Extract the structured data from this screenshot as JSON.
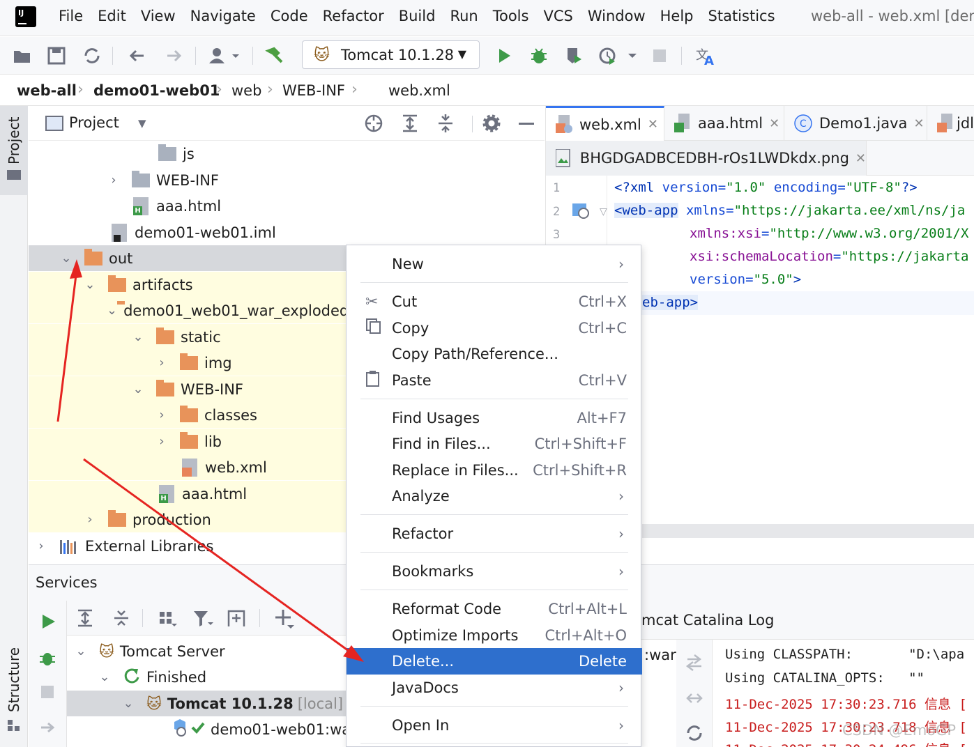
{
  "menubar": {
    "items": [
      "File",
      "Edit",
      "View",
      "Navigate",
      "Code",
      "Refactor",
      "Build",
      "Run",
      "Tools",
      "VCS",
      "Window",
      "Help",
      "Statistics"
    ],
    "window_title": "web-all - web.xml [dem"
  },
  "toolbar": {
    "run_config": "Tomcat 10.1.28"
  },
  "breadcrumb": [
    "web-all",
    "demo01-web01",
    "web",
    "WEB-INF",
    "web.xml"
  ],
  "leftstrip": {
    "project": "Project",
    "structure": "Structure"
  },
  "project": {
    "title": "Project",
    "tree": [
      {
        "label": "js",
        "type": "folder-gray"
      },
      {
        "label": "WEB-INF",
        "type": "folder-gray"
      },
      {
        "label": "aaa.html",
        "type": "html"
      },
      {
        "label": "demo01-web01.iml",
        "type": "iml"
      },
      {
        "label": "out",
        "type": "folder-orange"
      },
      {
        "label": "artifacts",
        "type": "folder-orange"
      },
      {
        "label": "demo01_web01_war_exploded",
        "type": "folder-orange"
      },
      {
        "label": "static",
        "type": "folder-orange"
      },
      {
        "label": "img",
        "type": "folder-orange"
      },
      {
        "label": "WEB-INF",
        "type": "folder-orange"
      },
      {
        "label": "classes",
        "type": "folder-orange"
      },
      {
        "label": "lib",
        "type": "folder-orange"
      },
      {
        "label": "web.xml",
        "type": "xml"
      },
      {
        "label": "aaa.html",
        "type": "html"
      },
      {
        "label": "production",
        "type": "folder-orange"
      },
      {
        "label": "External Libraries",
        "type": "libs"
      }
    ]
  },
  "editor": {
    "tabs": [
      "web.xml",
      "aaa.html",
      "Demo1.java",
      "jdl"
    ],
    "tab2": "BHGDGADBCEDBH-rOs1LWDkdx.png",
    "lines": [
      "1",
      "2",
      "3"
    ],
    "code": {
      "l1a": "<?",
      "l1b": "xml",
      "l1c": " version=",
      "l1d": "\"1.0\"",
      "l1e": " encoding=",
      "l1f": "\"UTF-8\"",
      "l1g": "?>",
      "l2a": "<web-app",
      "l2b": " xmlns=",
      "l2c": "\"https://jakarta.ee/xml/ns/ja",
      "l3a": "xmlns:xsi",
      "l3b": "=",
      "l3c": "\"http://www.w3.org/2001/X",
      "l4a": "xsi:schemaLocation",
      "l4b": "=",
      "l4c": "\"https://jakarta",
      "l5a": "version",
      "l5b": "=",
      "l5c": "\"5.0\"",
      "l5d": ">",
      "l6a": "eb-app",
      "l6b": ">"
    }
  },
  "services": {
    "title": "Services",
    "tree": {
      "server": "Tomcat Server",
      "finished": "Finished",
      "tomcat": "Tomcat 10.1.28",
      "tomcat_suffix": "[local]",
      "artifact": "demo01-web01:wa"
    },
    "log_tab": "mcat Catalina Log",
    "war_label": ":war",
    "log_lines": [
      "Using CLASSPATH:       \"D:\\apa",
      "Using CATALINA_OPTS:   \"\"",
      "11-Dec-2025 17:30:23.716 信息 [",
      "11-Dec-2025 17:30:23.718 信息 [",
      "11-Dec-2025 17:30:24.496 信息 ["
    ]
  },
  "context_menu": {
    "new": "New",
    "cut": "Cut",
    "cut_sc": "Ctrl+X",
    "copy": "Copy",
    "copy_sc": "Ctrl+C",
    "copy_path": "Copy Path/Reference...",
    "paste": "Paste",
    "paste_sc": "Ctrl+V",
    "find_usages": "Find Usages",
    "find_usages_sc": "Alt+F7",
    "find_in_files": "Find in Files...",
    "find_in_files_sc": "Ctrl+Shift+F",
    "replace_in_files": "Replace in Files...",
    "replace_in_files_sc": "Ctrl+Shift+R",
    "analyze": "Analyze",
    "refactor": "Refactor",
    "bookmarks": "Bookmarks",
    "reformat": "Reformat Code",
    "reformat_sc": "Ctrl+Alt+L",
    "optimize": "Optimize Imports",
    "optimize_sc": "Ctrl+Alt+O",
    "delete": "Delete...",
    "delete_sc": "Delete",
    "javadocs": "JavaDocs",
    "open_in": "Open In"
  },
  "watermark": "CSDN @EmoGP",
  "colors": {
    "accent": "#2e6fcd",
    "folder_orange": "#e8935a",
    "annotation_red": "#e52421"
  }
}
